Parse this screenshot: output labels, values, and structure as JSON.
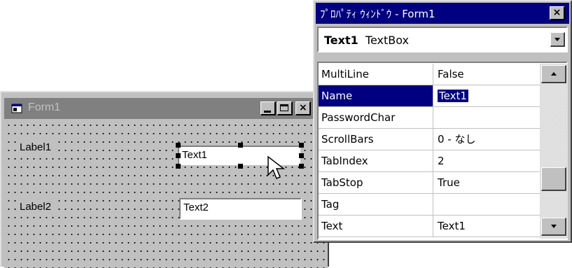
{
  "form_window": {
    "title": "Form1",
    "controls": {
      "label1": "Label1",
      "label2": "Label2",
      "text1": "Text1",
      "text2": "Text2"
    }
  },
  "properties_window": {
    "title": "ﾌﾟﾛﾊﾟﾃｨ ｳｨﾝﾄﾞｳ - Form1",
    "close_glyph": "×",
    "object_name": "Text1",
    "object_type": "TextBox",
    "properties": [
      {
        "name": "MultiLine",
        "value": "False"
      },
      {
        "name": "Name",
        "value": "Text1",
        "selected": true
      },
      {
        "name": "PasswordChar",
        "value": ""
      },
      {
        "name": "ScrollBars",
        "value": "0 - なし"
      },
      {
        "name": "TabIndex",
        "value": "2"
      },
      {
        "name": "TabStop",
        "value": "True"
      },
      {
        "name": "Tag",
        "value": ""
      },
      {
        "name": "Text",
        "value": "Text1"
      }
    ]
  },
  "colors": {
    "active_title": "#000080",
    "inactive_title": "#808080",
    "face": "#c0c0c0"
  }
}
